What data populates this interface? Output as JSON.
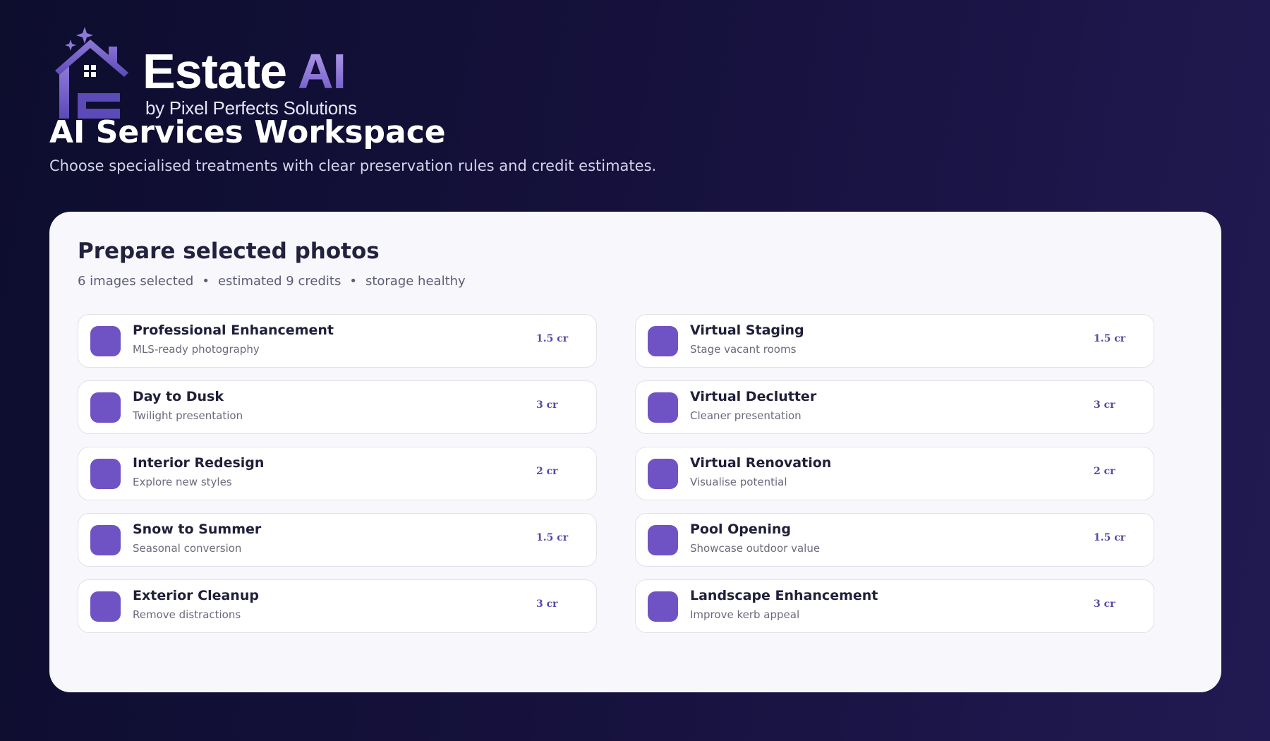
{
  "brand": {
    "name": "Estate",
    "name_accent": "AI",
    "tagline": "by Pixel Perfects Solutions",
    "logo_icon": "house-sparkle-icon",
    "accent_color": "#6f53c4"
  },
  "header": {
    "title": "AI Services Workspace",
    "subtitle": "Choose specialised treatments with clear preservation rules and credit estimates."
  },
  "panel": {
    "title": "Prepare selected photos",
    "meta": [
      "6 images selected",
      "estimated 9 credits",
      "storage healthy"
    ],
    "separator": "•",
    "services": [
      {
        "title": "Professional Enhancement",
        "desc": "MLS-ready photography",
        "credit": "1.5 cr"
      },
      {
        "title": "Virtual Staging",
        "desc": "Stage vacant rooms",
        "credit": "1.5 cr"
      },
      {
        "title": "Day to Dusk",
        "desc": "Twilight presentation",
        "credit": "3 cr"
      },
      {
        "title": "Virtual Declutter",
        "desc": "Cleaner presentation",
        "credit": "3 cr"
      },
      {
        "title": "Interior Redesign",
        "desc": "Explore new styles",
        "credit": "2 cr"
      },
      {
        "title": "Virtual Renovation",
        "desc": "Visualise potential",
        "credit": "2 cr"
      },
      {
        "title": "Snow to Summer",
        "desc": "Seasonal conversion",
        "credit": "1.5 cr"
      },
      {
        "title": "Pool Opening",
        "desc": "Showcase outdoor value",
        "credit": "1.5 cr"
      },
      {
        "title": "Exterior Cleanup",
        "desc": "Remove distractions",
        "credit": "3 cr"
      },
      {
        "title": "Landscape Enhancement",
        "desc": "Improve kerb appeal",
        "credit": "3 cr"
      }
    ]
  }
}
